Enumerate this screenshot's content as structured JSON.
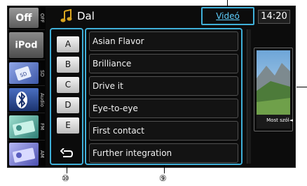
{
  "rail": {
    "items": [
      {
        "tile_text": "Off",
        "side_label": "OFF",
        "tile_color": "#7a7a7a"
      },
      {
        "tile_text": "iPod",
        "side_label": "",
        "tile_color": "#6a6a6a"
      },
      {
        "tile_text": "",
        "side_label": "SD",
        "tile_color": "#5a6fb8",
        "icon": "sd-card-icon"
      },
      {
        "tile_text": "",
        "side_label": "Audio",
        "tile_color": "#2d4f9a",
        "icon": "bluetooth-icon"
      },
      {
        "tile_text": "",
        "side_label": "FM",
        "tile_color": "#3f8f86",
        "icon": "radio-icon"
      },
      {
        "tile_text": "",
        "side_label": "AM",
        "tile_color": "#6b6fc8",
        "icon": "radio-am-icon"
      }
    ]
  },
  "header": {
    "title": "Dal",
    "video_tab": "Videó",
    "clock": "14:20",
    "note_icon": "music-note-icon"
  },
  "alphabet": [
    "A",
    "B",
    "C",
    "D",
    "E"
  ],
  "back_icon": "back-arrow-icon",
  "songs": [
    "Asian Flavor",
    "Brilliance",
    "Drive it",
    "Eye-to-eye",
    "First contact",
    "Further integration"
  ],
  "artwork": {
    "caption": "Most szól◄"
  },
  "callouts": {
    "alphabet": "⑩",
    "list": "⑨"
  },
  "colors": {
    "accent": "#3fb0d9",
    "tab_text": "#5fd0ff"
  }
}
